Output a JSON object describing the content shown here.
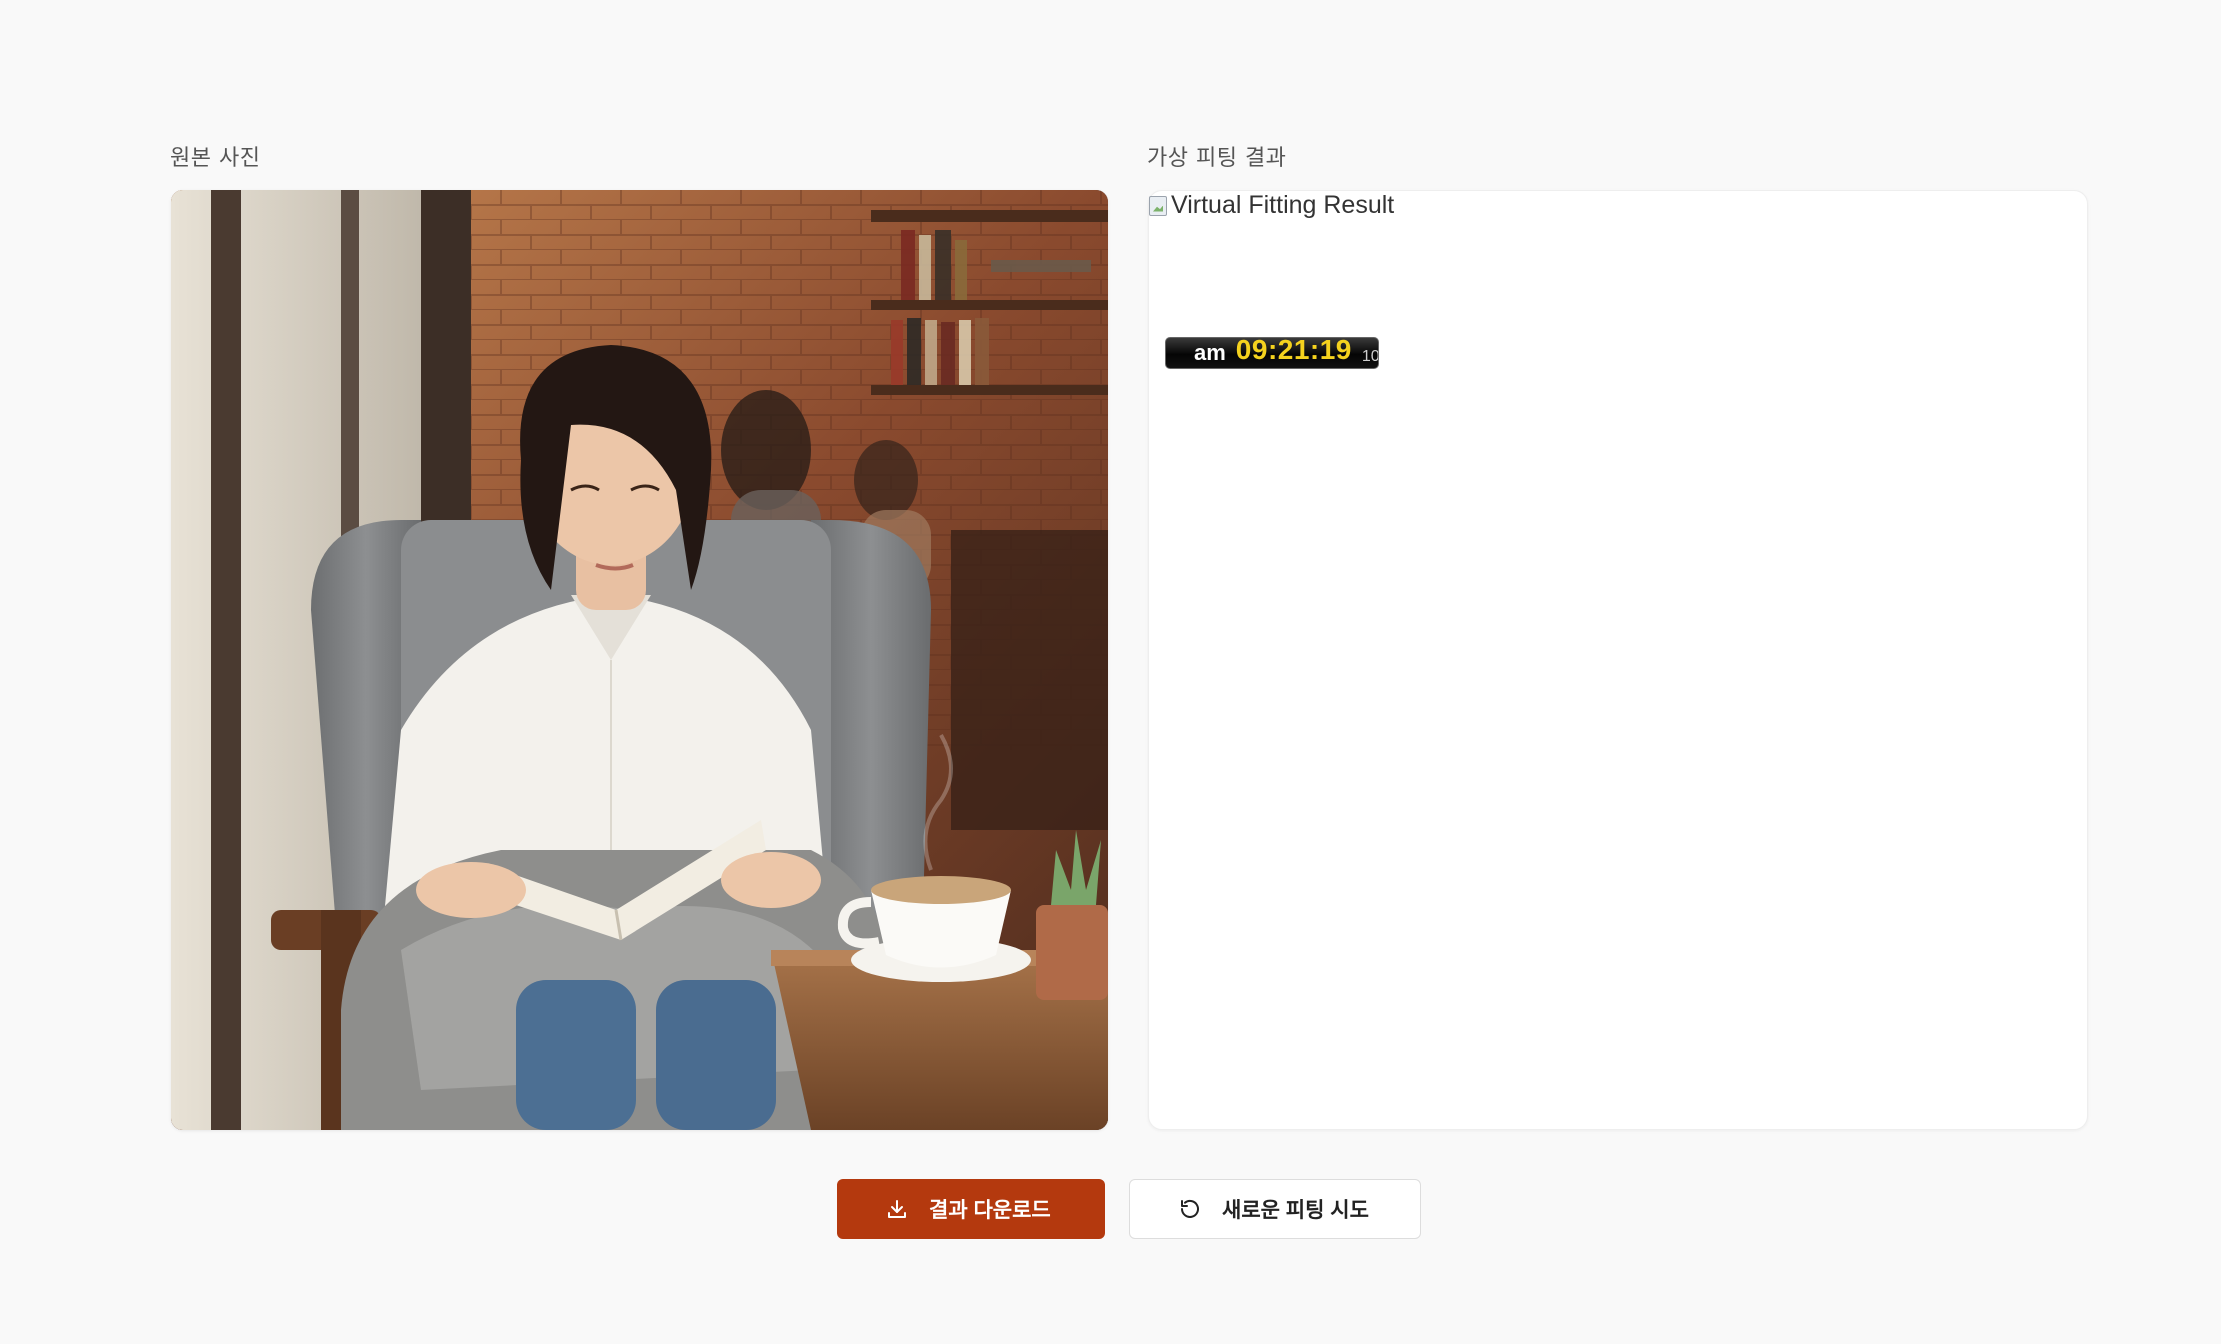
{
  "original_panel": {
    "label": "원본 사진",
    "image_icon": "photo-woman-reading-in-cafe"
  },
  "result_panel": {
    "label": "가상 피팅 결과",
    "image_alt": "Virtual Fitting Result",
    "clock": {
      "ampm": "am",
      "time": "09:21:19",
      "extra": "10"
    }
  },
  "actions": {
    "download_label": "결과 다운로드",
    "download_icon": "download-icon",
    "retry_label": "새로운 피팅 시도",
    "retry_icon": "refresh-icon"
  },
  "colors": {
    "primary_button": "#b4390e",
    "background": "#f9f9f9",
    "clock_digits": "#f5d21e"
  }
}
